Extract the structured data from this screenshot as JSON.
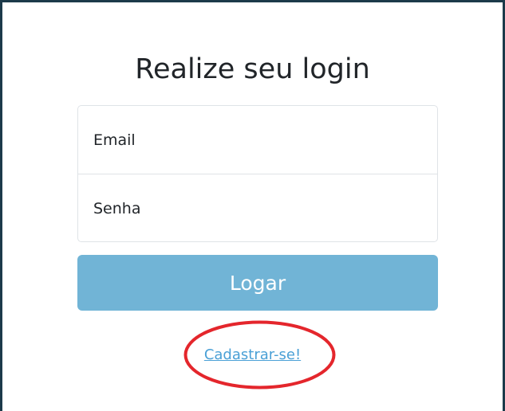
{
  "page": {
    "title": "Realize seu login"
  },
  "form": {
    "email_placeholder": "Email",
    "password_placeholder": "Senha",
    "submit_label": "Logar"
  },
  "register": {
    "link_text": "Cadastrar-se!"
  },
  "colors": {
    "button_bg": "#71b4d6",
    "link": "#4aa0d6",
    "annotation": "#e4262c",
    "frame_border": "#1c3a4a"
  }
}
